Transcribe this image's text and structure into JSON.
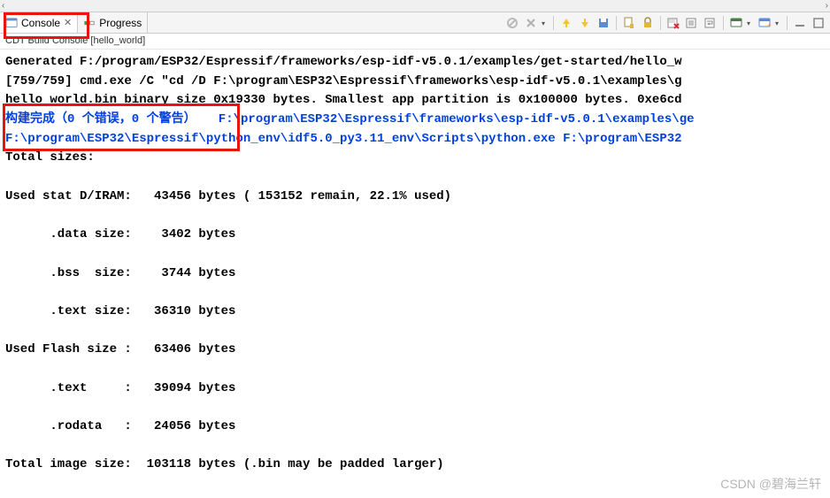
{
  "top_scroll": {
    "left": "‹",
    "right": "›"
  },
  "tabs": {
    "console": {
      "label": "Console",
      "close": "✕"
    },
    "progress": {
      "label": "Progress"
    }
  },
  "subheader": "CDT Build Console [hello_world]",
  "toolbar": {
    "stop": "stop",
    "remove": "remove",
    "up": "up",
    "down": "down",
    "organize": "organize",
    "lock": "lock",
    "clear": "clear",
    "scroll": "scroll",
    "wrap": "wrap",
    "terminal": "terminal",
    "newconsole": "newconsole",
    "min": "min",
    "max": "max"
  },
  "console_lines": [
    {
      "cls": "",
      "text": "Generated F:/program/ESP32/Espressif/frameworks/esp-idf-v5.0.1/examples/get-started/hello_w"
    },
    {
      "cls": "",
      "text": "[759/759] cmd.exe /C \"cd /D F:\\program\\ESP32\\Espressif\\frameworks\\esp-idf-v5.0.1\\examples\\g"
    },
    {
      "cls": "",
      "text": "hello_world.bin binary size 0x19330 bytes. Smallest app partition is 0x100000 bytes. 0xe6cd"
    },
    {
      "cls": "blue",
      "text": "构建完成（0 个错误，0 个警告）   F:\\program\\ESP32\\Espressif\\frameworks\\esp-idf-v5.0.1\\examples\\ge"
    },
    {
      "cls": "blue",
      "text": "F:\\program\\ESP32\\Espressif\\python_env\\idf5.0_py3.11_env\\Scripts\\python.exe F:\\program\\ESP32"
    },
    {
      "cls": "",
      "text": "Total sizes:"
    },
    {
      "cls": "",
      "text": ""
    },
    {
      "cls": "",
      "text": "Used stat D/IRAM:   43456 bytes ( 153152 remain, 22.1% used)"
    },
    {
      "cls": "",
      "text": ""
    },
    {
      "cls": "",
      "text": "      .data size:    3402 bytes"
    },
    {
      "cls": "",
      "text": ""
    },
    {
      "cls": "",
      "text": "      .bss  size:    3744 bytes"
    },
    {
      "cls": "",
      "text": ""
    },
    {
      "cls": "",
      "text": "      .text size:   36310 bytes"
    },
    {
      "cls": "",
      "text": ""
    },
    {
      "cls": "",
      "text": "Used Flash size :   63406 bytes"
    },
    {
      "cls": "",
      "text": ""
    },
    {
      "cls": "",
      "text": "      .text     :   39094 bytes"
    },
    {
      "cls": "",
      "text": ""
    },
    {
      "cls": "",
      "text": "      .rodata   :   24056 bytes"
    },
    {
      "cls": "",
      "text": ""
    },
    {
      "cls": "",
      "text": "Total image size:  103118 bytes (.bin may be padded larger)"
    }
  ],
  "watermark": "CSDN @碧海兰轩"
}
